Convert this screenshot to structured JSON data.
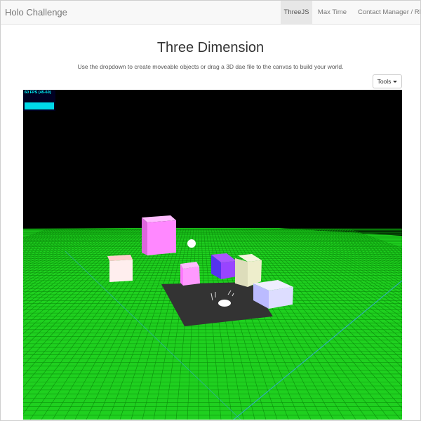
{
  "navbar": {
    "brand": "Holo Challenge",
    "items": [
      {
        "label": "ThreeJS",
        "active": true
      },
      {
        "label": "Max Time",
        "active": false
      },
      {
        "label": "Contact Manager / REST",
        "active": false
      }
    ]
  },
  "page": {
    "title": "Three Dimension",
    "subtitle": "Use the dropdown to create moveable objects or drag a 3D dae file to the canvas to build your world."
  },
  "toolbar": {
    "tools_label": "Tools"
  },
  "scene": {
    "fps_label": "60 FPS (45-60)",
    "background_color": "#000000",
    "ground_color": "#22dd22",
    "grid_line_color": "#11aa11",
    "axis_color": "#33aacc",
    "platform_color": "#333333",
    "objects": [
      {
        "type": "cube",
        "color": "#ff88ff"
      },
      {
        "type": "sphere",
        "color": "#ffffff"
      },
      {
        "type": "cube",
        "color": "#ffeeee"
      },
      {
        "type": "cube",
        "color": "#ff99ff"
      },
      {
        "type": "cube",
        "color": "#6633ff"
      },
      {
        "type": "cube",
        "color": "#eeeecc"
      },
      {
        "type": "cube",
        "color": "#ddddff"
      },
      {
        "type": "model",
        "color": "#ffffff"
      }
    ]
  }
}
